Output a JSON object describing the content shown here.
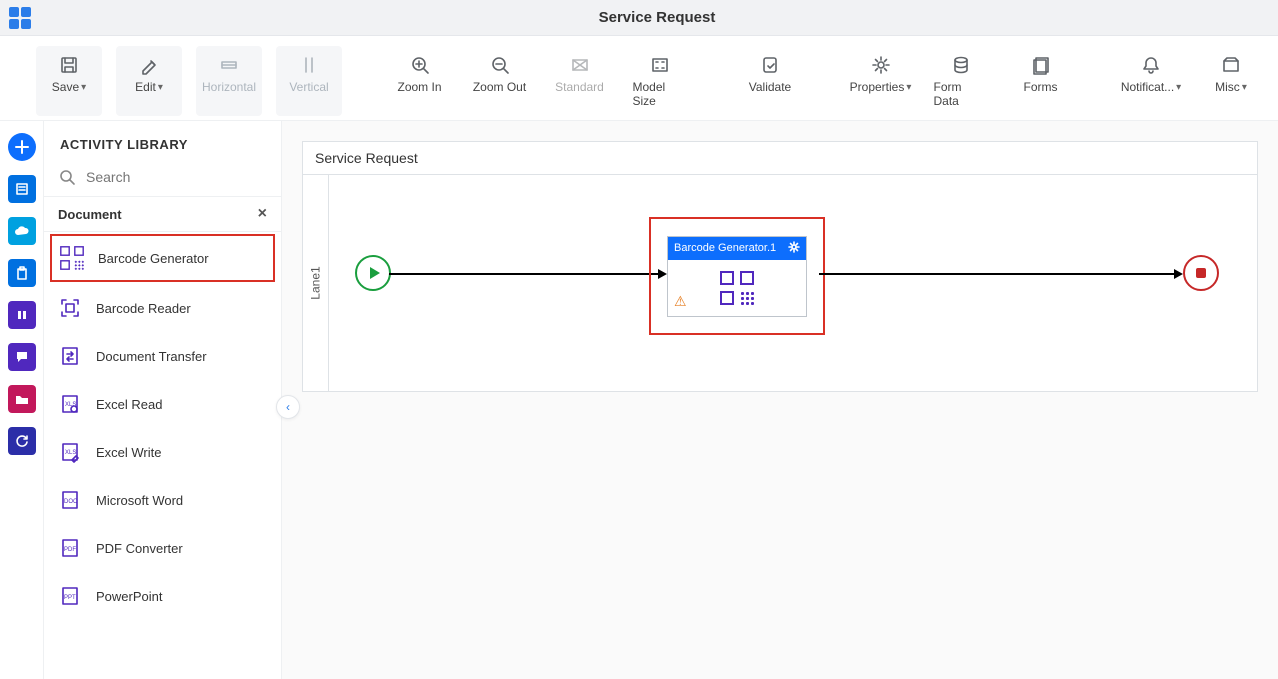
{
  "title": "Service Request",
  "toolbar": {
    "save": "Save",
    "edit": "Edit",
    "horizontal": "Horizontal",
    "vertical": "Vertical",
    "zoom_in": "Zoom In",
    "zoom_out": "Zoom Out",
    "standard": "Standard",
    "model_size": "Model Size",
    "validate": "Validate",
    "properties": "Properties",
    "form_data": "Form Data",
    "forms": "Forms",
    "notifications": "Notificat...",
    "misc": "Misc"
  },
  "library": {
    "title": "ACTIVITY LIBRARY",
    "search_placeholder": "Search",
    "section": "Document",
    "items": {
      "barcode_generator": "Barcode Generator",
      "barcode_reader": "Barcode Reader",
      "document_transfer": "Document Transfer",
      "excel_read": "Excel Read",
      "excel_write": "Excel Write",
      "microsoft_word": "Microsoft Word",
      "pdf_converter": "PDF Converter",
      "powerpoint": "PowerPoint"
    }
  },
  "process": {
    "title": "Service Request",
    "lane": "Lane1",
    "activity_title": "Barcode Generator.1"
  }
}
